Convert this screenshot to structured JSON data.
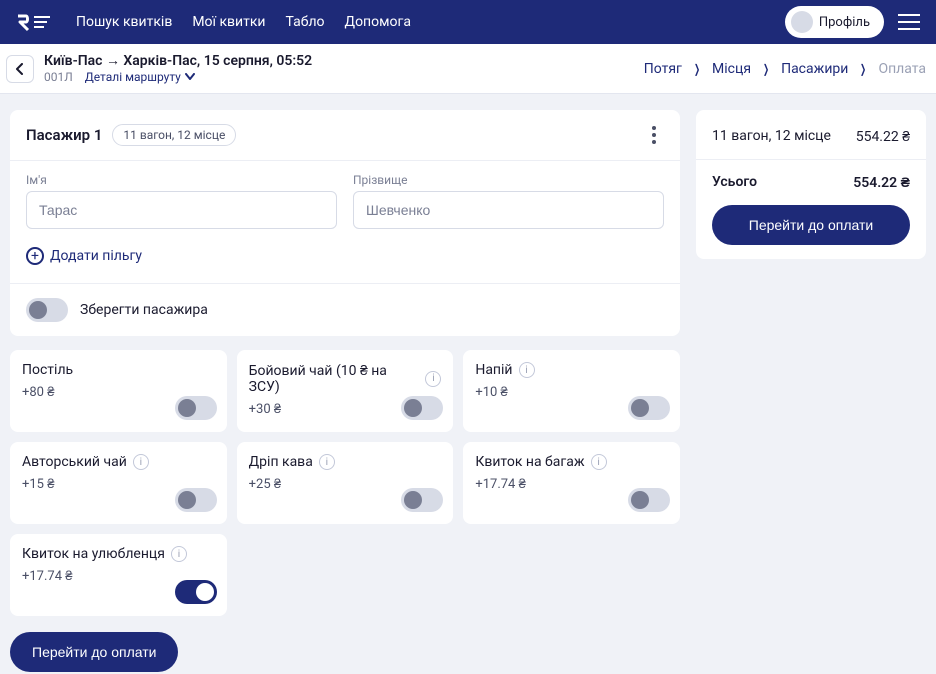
{
  "nav": {
    "items": [
      "Пошук квитків",
      "Мої квитки",
      "Табло",
      "Допомога"
    ],
    "profile_label": "Профіль"
  },
  "subheader": {
    "route": "Київ-Пас → Харків-Пас, 15 серпня, 05:52",
    "train_no": "001Л",
    "details_link": "Деталі маршруту"
  },
  "steps": [
    "Потяг",
    "Місця",
    "Пасажири",
    "Оплата"
  ],
  "passenger": {
    "title": "Пасажир 1",
    "seat_chip": "11 вагон, 12 місце",
    "first_label": "Ім'я",
    "first_value": "Тарас",
    "last_label": "Прізвище",
    "last_value": "Шевченко",
    "add_benefit": "Додати пільгу",
    "save_label": "Зберегти пасажира"
  },
  "extras": [
    {
      "name": "Постіль",
      "price": "+80 ₴",
      "info": false,
      "on": false
    },
    {
      "name": "Бойовий чай (10 ₴ на ЗСУ)",
      "price": "+30 ₴",
      "info": true,
      "on": false
    },
    {
      "name": "Напій",
      "price": "+10 ₴",
      "info": true,
      "on": false
    },
    {
      "name": "Авторський чай",
      "price": "+15 ₴",
      "info": true,
      "on": false
    },
    {
      "name": "Дріп кава",
      "price": "+25 ₴",
      "info": true,
      "on": false
    },
    {
      "name": "Квиток на багаж",
      "price": "+17.74 ₴",
      "info": true,
      "on": false
    },
    {
      "name": "Квиток на улюбленця",
      "price": "+17.74 ₴",
      "info": true,
      "on": true
    }
  ],
  "summary": {
    "seat_label": "11 вагон, 12 місце",
    "seat_price": "554.22 ₴",
    "total_label": "Усього",
    "total_price": "554.22 ₴",
    "pay_button": "Перейти до оплати"
  }
}
